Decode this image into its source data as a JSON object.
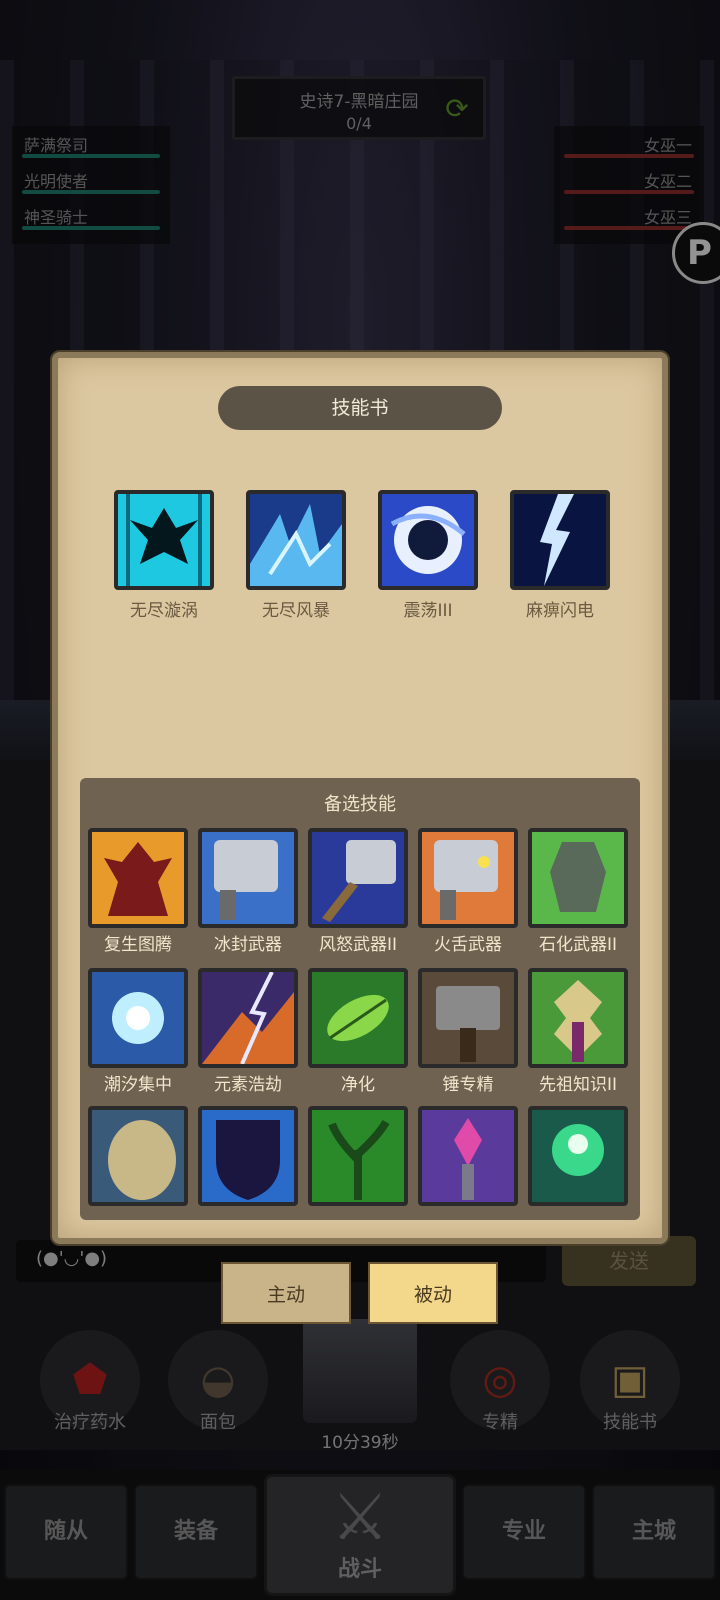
{
  "stage": {
    "title": "史诗7-黑暗庄园",
    "progress": "0/4"
  },
  "team_left": [
    "萨满祭司",
    "光明使者",
    "神圣骑士"
  ],
  "team_right": [
    "女巫一",
    "女巫二",
    "女巫三"
  ],
  "dialog": {
    "title": "技能书",
    "equipped": [
      "无尽漩涡",
      "无尽风暴",
      "震荡III",
      "麻痹闪电"
    ],
    "alternates_title": "备选技能",
    "alternates": [
      "复生图腾",
      "冰封武器",
      "风怒武器II",
      "火舌武器",
      "石化武器II",
      "潮汐集中",
      "元素浩劫",
      "净化",
      "锤专精",
      "先祖知识II",
      "",
      "",
      "",
      "",
      ""
    ]
  },
  "chat": {
    "emoji": "(●'◡'●)",
    "send_label": "发送"
  },
  "tabs": {
    "active": "主动",
    "passive": "被动"
  },
  "dock": {
    "potion": "治疗药水",
    "bread": "面包",
    "chest_timer": "10分39秒",
    "specialize": "专精",
    "skillbook": "技能书"
  },
  "nav": {
    "followers": "随从",
    "equipment": "装备",
    "battle": "战斗",
    "profession": "专业",
    "city": "主城"
  },
  "colors": {
    "dialog_bg": "#dcc8a0",
    "panel_bg": "#6f6250",
    "tab_passive": "#f3d78a",
    "hp_ally": "#1d7a6a",
    "hp_enemy": "#8a2a2a"
  }
}
